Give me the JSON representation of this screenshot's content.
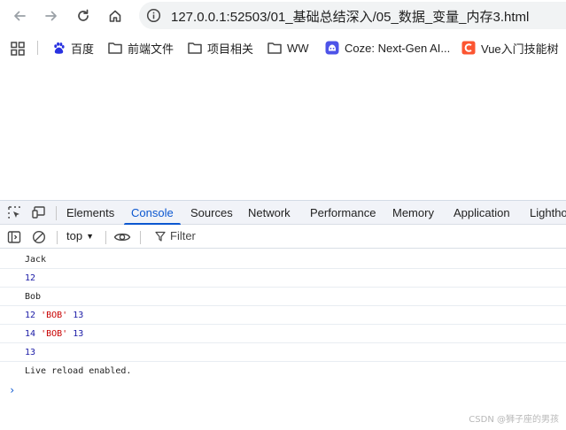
{
  "browser": {
    "url": "127.0.0.1:52503/01_基础总结深入/05_数据_变量_内存3.html"
  },
  "bookmarks": [
    {
      "icon": "baidu-paw-icon",
      "label": "百度"
    },
    {
      "icon": "folder-icon",
      "label": "前端文件"
    },
    {
      "icon": "folder-icon",
      "label": "项目相关"
    },
    {
      "icon": "folder-icon",
      "label": "WW"
    },
    {
      "icon": "coze-icon",
      "label": "Coze: Next-Gen AI..."
    },
    {
      "icon": "csdn-c-icon",
      "label": "Vue入门技能树"
    }
  ],
  "devtools": {
    "tabs": [
      "Elements",
      "Console",
      "Sources",
      "Network",
      "Performance",
      "Memory",
      "Application",
      "Lightho"
    ],
    "active_tab": "Console",
    "context": "top",
    "filter_label": "Filter"
  },
  "console": {
    "lines": [
      {
        "parts": [
          {
            "t": "Jack",
            "c": "text"
          }
        ]
      },
      {
        "parts": [
          {
            "t": "12",
            "c": "num"
          }
        ]
      },
      {
        "parts": [
          {
            "t": "Bob",
            "c": "text"
          }
        ]
      },
      {
        "parts": [
          {
            "t": "12",
            "c": "num"
          },
          {
            "t": " ",
            "c": "text"
          },
          {
            "t": "'BOB'",
            "c": "str"
          },
          {
            "t": " ",
            "c": "text"
          },
          {
            "t": "13",
            "c": "num"
          }
        ]
      },
      {
        "parts": [
          {
            "t": "14",
            "c": "num"
          },
          {
            "t": " ",
            "c": "text"
          },
          {
            "t": "'BOB'",
            "c": "str"
          },
          {
            "t": " ",
            "c": "text"
          },
          {
            "t": "13",
            "c": "num"
          }
        ]
      },
      {
        "parts": [
          {
            "t": "13",
            "c": "num"
          }
        ]
      },
      {
        "parts": [
          {
            "t": "Live reload enabled.",
            "c": "text"
          }
        ]
      }
    ],
    "prompt": "›"
  },
  "watermark": "CSDN @狮子座的男孩",
  "colors": {
    "accent": "#0b57d0",
    "number": "#1a1aa6",
    "string": "#c80000"
  }
}
